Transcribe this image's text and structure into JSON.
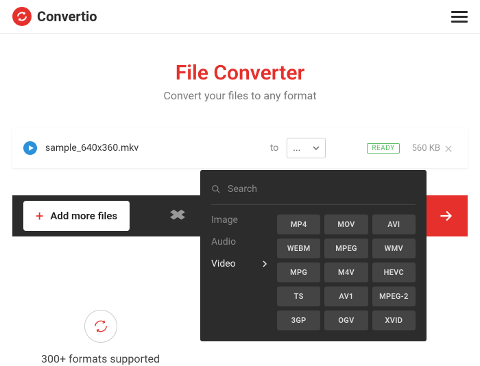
{
  "logo_text": "Convertio",
  "title": "File Converter",
  "subtitle": "Convert your files to any format",
  "file": {
    "name": "sample_640x360.mkv",
    "to": "to",
    "selector": "...",
    "badge": "READY",
    "size": "560 KB"
  },
  "add_more": "Add more files",
  "dropdown": {
    "search": "Search",
    "cats": {
      "image": "Image",
      "audio": "Audio",
      "video": "Video"
    },
    "formats": [
      "MP4",
      "MOV",
      "AVI",
      "WEBM",
      "MPEG",
      "WMV",
      "MPG",
      "M4V",
      "HEVC",
      "TS",
      "AV1",
      "MPEG-2",
      "3GP",
      "OGV",
      "XVID"
    ]
  },
  "feature1": "300+ formats supported"
}
